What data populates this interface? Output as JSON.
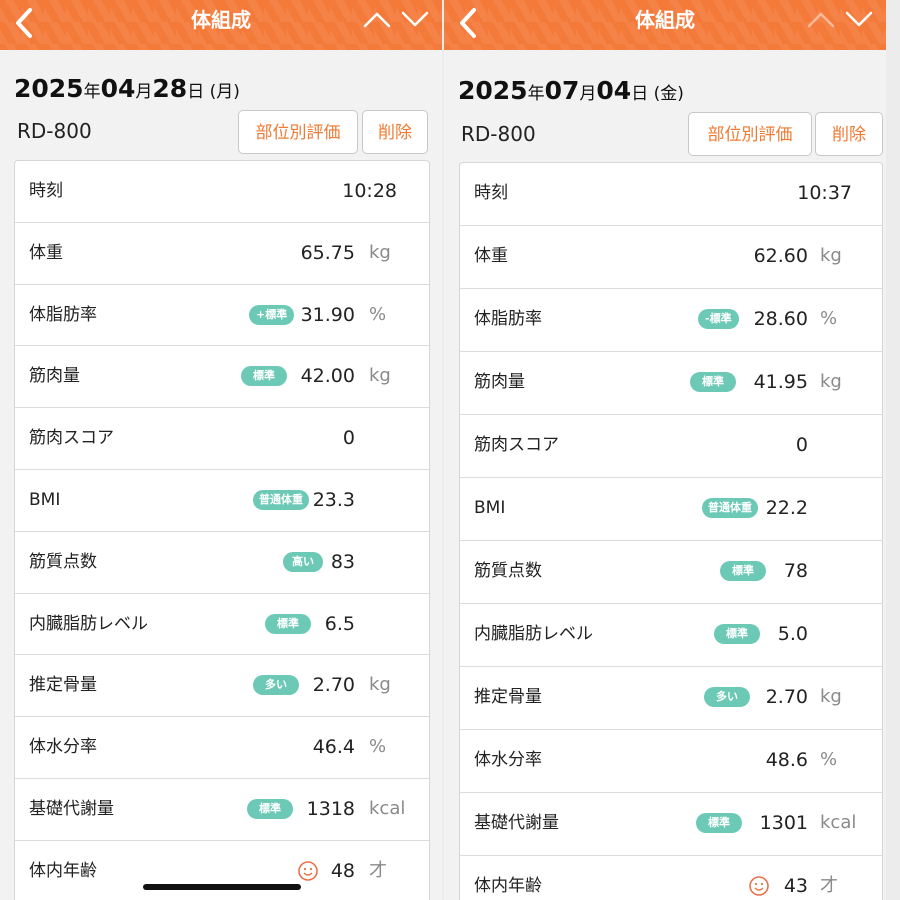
{
  "panels": [
    {
      "header_title": "体組成",
      "date": {
        "year": "2025",
        "y": "年",
        "month": "04",
        "m": "月",
        "day": "28",
        "d": "日",
        "weekday": "(月)"
      },
      "device": "RD-800",
      "buttons": {
        "part": "部位別評価",
        "delete": "削除"
      },
      "rows": [
        {
          "label": "時刻",
          "value": "10:28",
          "unit": "",
          "badge": ""
        },
        {
          "label": "体重",
          "value": "65.75",
          "unit": "kg",
          "badge": ""
        },
        {
          "label": "体脂肪率",
          "value": "31.90",
          "unit": "%",
          "badge": "+標準"
        },
        {
          "label": "筋肉量",
          "value": "42.00",
          "unit": "kg",
          "badge": "標準"
        },
        {
          "label": "筋肉スコア",
          "value": "0",
          "unit": "",
          "badge": ""
        },
        {
          "label": "BMI",
          "value": "23.3",
          "unit": "",
          "badge": "普通体重"
        },
        {
          "label": "筋質点数",
          "value": "83",
          "unit": "",
          "badge": "高い"
        },
        {
          "label": "内臓脂肪レベル",
          "value": "6.5",
          "unit": "",
          "badge": "標準"
        },
        {
          "label": "推定骨量",
          "value": "2.70",
          "unit": "kg",
          "badge": "多い"
        },
        {
          "label": "体水分率",
          "value": "46.4",
          "unit": "%",
          "badge": ""
        },
        {
          "label": "基礎代謝量",
          "value": "1318",
          "unit": "kcal",
          "badge": "標準"
        },
        {
          "label": "体内年齢",
          "value": "48",
          "unit": "才",
          "badge": ""
        }
      ]
    },
    {
      "header_title": "体組成",
      "date": {
        "year": "2025",
        "y": "年",
        "month": "07",
        "m": "月",
        "day": "04",
        "d": "日",
        "weekday": "(金)"
      },
      "device": "RD-800",
      "buttons": {
        "part": "部位別評価",
        "delete": "削除"
      },
      "rows": [
        {
          "label": "時刻",
          "value": "10:37",
          "unit": "",
          "badge": ""
        },
        {
          "label": "体重",
          "value": "62.60",
          "unit": "kg",
          "badge": ""
        },
        {
          "label": "体脂肪率",
          "value": "28.60",
          "unit": "%",
          "badge": "-標準"
        },
        {
          "label": "筋肉量",
          "value": "41.95",
          "unit": "kg",
          "badge": "標準"
        },
        {
          "label": "筋肉スコア",
          "value": "0",
          "unit": "",
          "badge": ""
        },
        {
          "label": "BMI",
          "value": "22.2",
          "unit": "",
          "badge": "普通体重"
        },
        {
          "label": "筋質点数",
          "value": "78",
          "unit": "",
          "badge": "標準"
        },
        {
          "label": "内臓脂肪レベル",
          "value": "5.0",
          "unit": "",
          "badge": "標準"
        },
        {
          "label": "推定骨量",
          "value": "2.70",
          "unit": "kg",
          "badge": "多い"
        },
        {
          "label": "体水分率",
          "value": "48.6",
          "unit": "%",
          "badge": ""
        },
        {
          "label": "基礎代謝量",
          "value": "1301",
          "unit": "kcal",
          "badge": "標準"
        },
        {
          "label": "体内年齢",
          "value": "43",
          "unit": "才",
          "badge": ""
        }
      ]
    }
  ],
  "icons": {
    "back": "chevron-left-icon",
    "prev": "chevron-up-icon",
    "next": "chevron-down-icon",
    "age": "face-icon"
  },
  "colors": {
    "header": "#f47a3a",
    "accent": "#f07a33",
    "badge": "#6cc9b6",
    "face": "#e8734a"
  }
}
